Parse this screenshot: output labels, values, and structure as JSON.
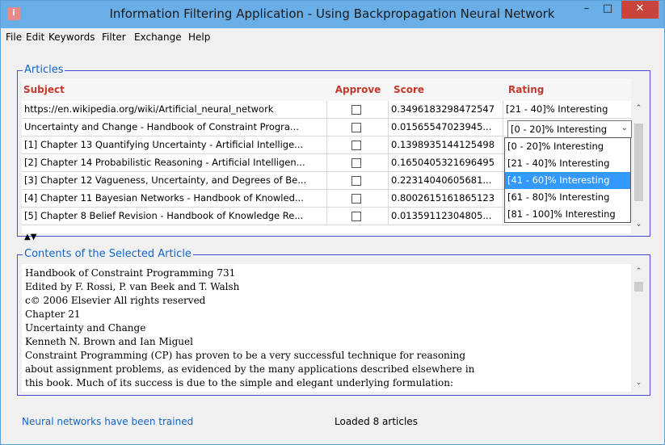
{
  "window": {
    "title": "Information Filtering Application - Using Backpropagation Neural Network",
    "app_icon": "app-icon",
    "controls": {
      "minimize": "–",
      "maximize": "□",
      "close": "✕"
    }
  },
  "menu": [
    "File",
    "Edit",
    "Keywords",
    "Filter",
    "Exchange",
    "Help"
  ],
  "articles_group": {
    "title": "Articles",
    "columns": {
      "subject": "Subject",
      "approve": "Approve",
      "score": "Score",
      "rating": "Rating"
    },
    "rows": [
      {
        "subject": "https://en.wikipedia.org/wiki/Artificial_neural_network",
        "approved": false,
        "score": "0.3496183298472547",
        "rating": "[21 - 40]% Interesting"
      },
      {
        "subject": "Uncertainty and Change - Handbook of Constraint Progra...",
        "approved": false,
        "score": "0.01565547023945...",
        "rating": "[0 - 20]% Interesting"
      },
      {
        "subject": "[1] Chapter 13 Quantifying Uncertainty - Artificial Intellige...",
        "approved": false,
        "score": "0.1398935144125498",
        "rating": ""
      },
      {
        "subject": "[2] Chapter 14 Probabilistic Reasoning - Artificial Intelligen...",
        "approved": false,
        "score": "0.1650405321696495",
        "rating": ""
      },
      {
        "subject": "[3] Chapter 12 Vagueness, Uncertainty, and Degrees of Be...",
        "approved": false,
        "score": "0.22314040605681...",
        "rating": ""
      },
      {
        "subject": "[4] Chapter 11 Bayesian Networks - Handbook of Knowled...",
        "approved": false,
        "score": "0.8002615161865123",
        "rating": ""
      },
      {
        "subject": "[5] Chapter 8 Belief Revision - Handbook of Knowledge Re...",
        "approved": false,
        "score": "0.01359112304805...",
        "rating": ""
      }
    ],
    "rating_combo": {
      "value": "[0 - 20]% Interesting",
      "options": [
        "[0 - 20]% Interesting",
        "[21 - 40]% Interesting",
        "[41 - 60]% Interesting",
        "[61 - 80]% Interesting",
        "[81 - 100]% Interesting"
      ],
      "highlighted": "[41 - 60]% Interesting"
    }
  },
  "contents_group": {
    "title": "Contents of the Selected Article",
    "lines": [
      "Handbook of Constraint Programming 731",
      "Edited by F. Rossi, P. van Beek and T. Walsh",
      "c© 2006 Elsevier All rights reserved",
      "Chapter 21",
      "Uncertainty and Change",
      "Kenneth N. Brown and Ian Miguel",
      "Constraint Programming (CP) has proven to be a very successful technique for reasoning",
      "about assignment problems, as evidenced by the many applications described elsewhere in",
      "this book. Much of its success is due to the simple and elegant underlying formulation:"
    ]
  },
  "status": {
    "left": "Neural networks have been trained",
    "right": "Loaded 8 articles"
  }
}
